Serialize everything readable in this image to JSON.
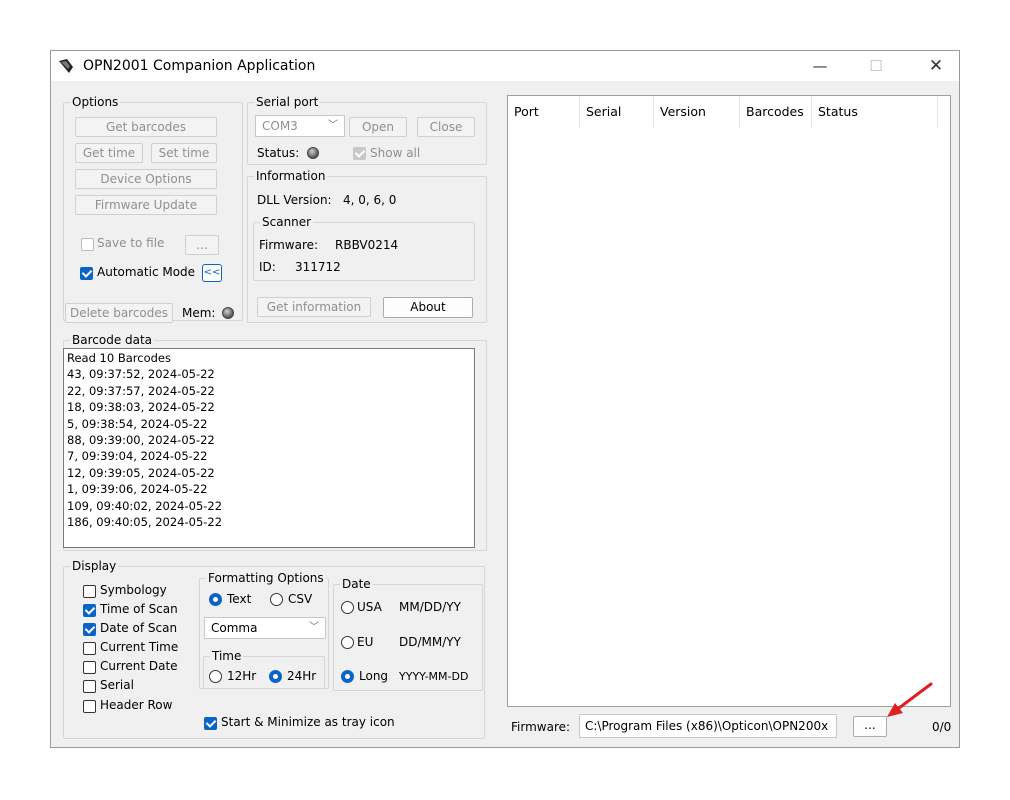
{
  "window": {
    "title": "OPN2001 Companion Application",
    "controls": {
      "minimize": "—",
      "maximize": "☐",
      "close": "✕"
    }
  },
  "options": {
    "legend": "Options",
    "get_barcodes": "Get barcodes",
    "get_time": "Get time",
    "set_time": "Set time",
    "device_options": "Device Options",
    "firmware_update": "Firmware Update",
    "save_to_file": "Save to file",
    "browse": "...",
    "automatic_mode": "Automatic Mode",
    "collapse": "<<",
    "delete_barcodes": "Delete barcodes",
    "mem_label": "Mem:"
  },
  "serial_port": {
    "legend": "Serial port",
    "port_value": "COM3",
    "open": "Open",
    "close": "Close",
    "status_label": "Status:",
    "show_all": "Show all"
  },
  "information": {
    "legend": "Information",
    "dll_label": "DLL Version:",
    "dll_value": "4, 0, 6, 0",
    "scanner_legend": "Scanner",
    "firmware_label": "Firmware:",
    "firmware_value": "RBBV0214",
    "id_label": "ID:",
    "id_value": "311712",
    "get_information": "Get information",
    "about": "About"
  },
  "barcode_data": {
    "legend": "Barcode data",
    "lines": [
      "Read 10 Barcodes",
      "43, 09:37:52, 2024-05-22",
      "22, 09:37:57, 2024-05-22",
      "18, 09:38:03, 2024-05-22",
      "5, 09:38:54, 2024-05-22",
      "88, 09:39:00, 2024-05-22",
      "7, 09:39:04, 2024-05-22",
      "12, 09:39:05, 2024-05-22",
      "1, 09:39:06, 2024-05-22",
      "109, 09:40:02, 2024-05-22",
      "186, 09:40:05, 2024-05-22"
    ]
  },
  "display": {
    "legend": "Display",
    "items": [
      {
        "label": "Symbology",
        "checked": false
      },
      {
        "label": "Time of Scan",
        "checked": true
      },
      {
        "label": "Date of Scan",
        "checked": true
      },
      {
        "label": "Current Time",
        "checked": false
      },
      {
        "label": "Current Date",
        "checked": false
      },
      {
        "label": "Serial",
        "checked": false
      },
      {
        "label": "Header Row",
        "checked": false
      }
    ]
  },
  "formatting": {
    "legend": "Formatting Options",
    "text": "Text",
    "csv": "CSV",
    "separator": "Comma",
    "time_legend": "Time",
    "h12": "12Hr",
    "h24": "24Hr",
    "date_legend": "Date",
    "usa": "USA",
    "usa_fmt": "MM/DD/YY",
    "eu": "EU",
    "eu_fmt": "DD/MM/YY",
    "long": "Long",
    "long_fmt": "YYYY-MM-DD"
  },
  "tray": {
    "label": "Start & Minimize as tray icon"
  },
  "devices": {
    "columns": [
      "Port",
      "Serial",
      "Version",
      "Barcodes",
      "Status"
    ]
  },
  "footer": {
    "firmware_label": "Firmware:",
    "firmware_path": "C:\\Program Files (x86)\\Opticon\\OPN200x",
    "browse": "...",
    "counter": "0/0"
  },
  "colors": {
    "accent": "#0a64c8",
    "arrow": "#e02020"
  }
}
